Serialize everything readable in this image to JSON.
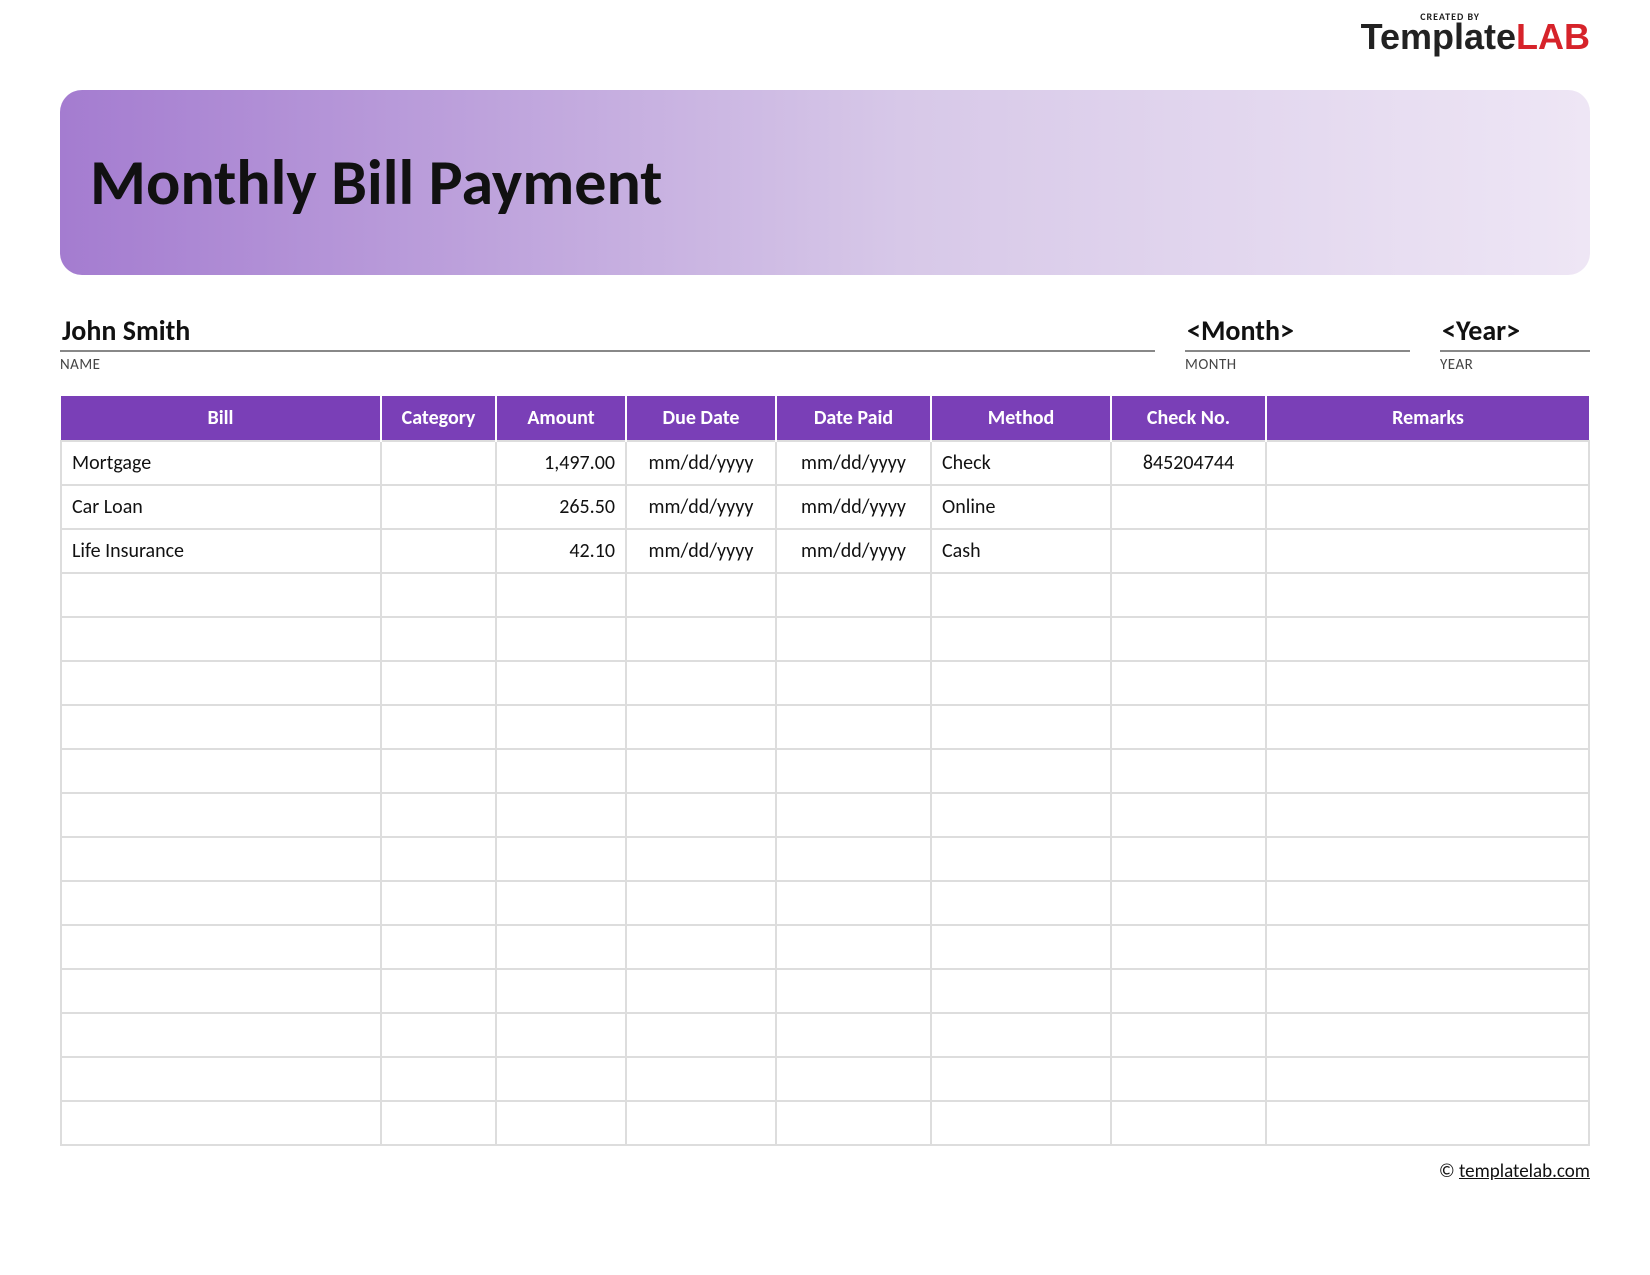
{
  "brand": {
    "created": "CREATED BY",
    "name_a": "Template",
    "name_b": "LAB"
  },
  "title": "Monthly Bill Payment",
  "meta": {
    "name_value": "John Smith",
    "name_label": "NAME",
    "month_value": "<Month>",
    "month_label": "MONTH",
    "year_value": "<Year>",
    "year_label": "YEAR"
  },
  "columns": {
    "bill": "Bill",
    "category": "Category",
    "amount": "Amount",
    "due": "Due Date",
    "paid": "Date Paid",
    "method": "Method",
    "check": "Check No.",
    "remarks": "Remarks"
  },
  "rows": [
    {
      "bill": "Mortgage",
      "category": "",
      "amount": "1,497.00",
      "due": "mm/dd/yyyy",
      "paid": "mm/dd/yyyy",
      "method": "Check",
      "check": "845204744",
      "remarks": ""
    },
    {
      "bill": "Car Loan",
      "category": "",
      "amount": "265.50",
      "due": "mm/dd/yyyy",
      "paid": "mm/dd/yyyy",
      "method": "Online",
      "check": "",
      "remarks": ""
    },
    {
      "bill": "Life Insurance",
      "category": "",
      "amount": "42.10",
      "due": "mm/dd/yyyy",
      "paid": "mm/dd/yyyy",
      "method": "Cash",
      "check": "",
      "remarks": ""
    },
    {
      "bill": "",
      "category": "",
      "amount": "",
      "due": "",
      "paid": "",
      "method": "",
      "check": "",
      "remarks": ""
    },
    {
      "bill": "",
      "category": "",
      "amount": "",
      "due": "",
      "paid": "",
      "method": "",
      "check": "",
      "remarks": ""
    },
    {
      "bill": "",
      "category": "",
      "amount": "",
      "due": "",
      "paid": "",
      "method": "",
      "check": "",
      "remarks": ""
    },
    {
      "bill": "",
      "category": "",
      "amount": "",
      "due": "",
      "paid": "",
      "method": "",
      "check": "",
      "remarks": ""
    },
    {
      "bill": "",
      "category": "",
      "amount": "",
      "due": "",
      "paid": "",
      "method": "",
      "check": "",
      "remarks": ""
    },
    {
      "bill": "",
      "category": "",
      "amount": "",
      "due": "",
      "paid": "",
      "method": "",
      "check": "",
      "remarks": ""
    },
    {
      "bill": "",
      "category": "",
      "amount": "",
      "due": "",
      "paid": "",
      "method": "",
      "check": "",
      "remarks": ""
    },
    {
      "bill": "",
      "category": "",
      "amount": "",
      "due": "",
      "paid": "",
      "method": "",
      "check": "",
      "remarks": ""
    },
    {
      "bill": "",
      "category": "",
      "amount": "",
      "due": "",
      "paid": "",
      "method": "",
      "check": "",
      "remarks": ""
    },
    {
      "bill": "",
      "category": "",
      "amount": "",
      "due": "",
      "paid": "",
      "method": "",
      "check": "",
      "remarks": ""
    },
    {
      "bill": "",
      "category": "",
      "amount": "",
      "due": "",
      "paid": "",
      "method": "",
      "check": "",
      "remarks": ""
    },
    {
      "bill": "",
      "category": "",
      "amount": "",
      "due": "",
      "paid": "",
      "method": "",
      "check": "",
      "remarks": ""
    },
    {
      "bill": "",
      "category": "",
      "amount": "",
      "due": "",
      "paid": "",
      "method": "",
      "check": "",
      "remarks": ""
    }
  ],
  "footer": {
    "copyright": "©",
    "link": "templatelab.com"
  }
}
